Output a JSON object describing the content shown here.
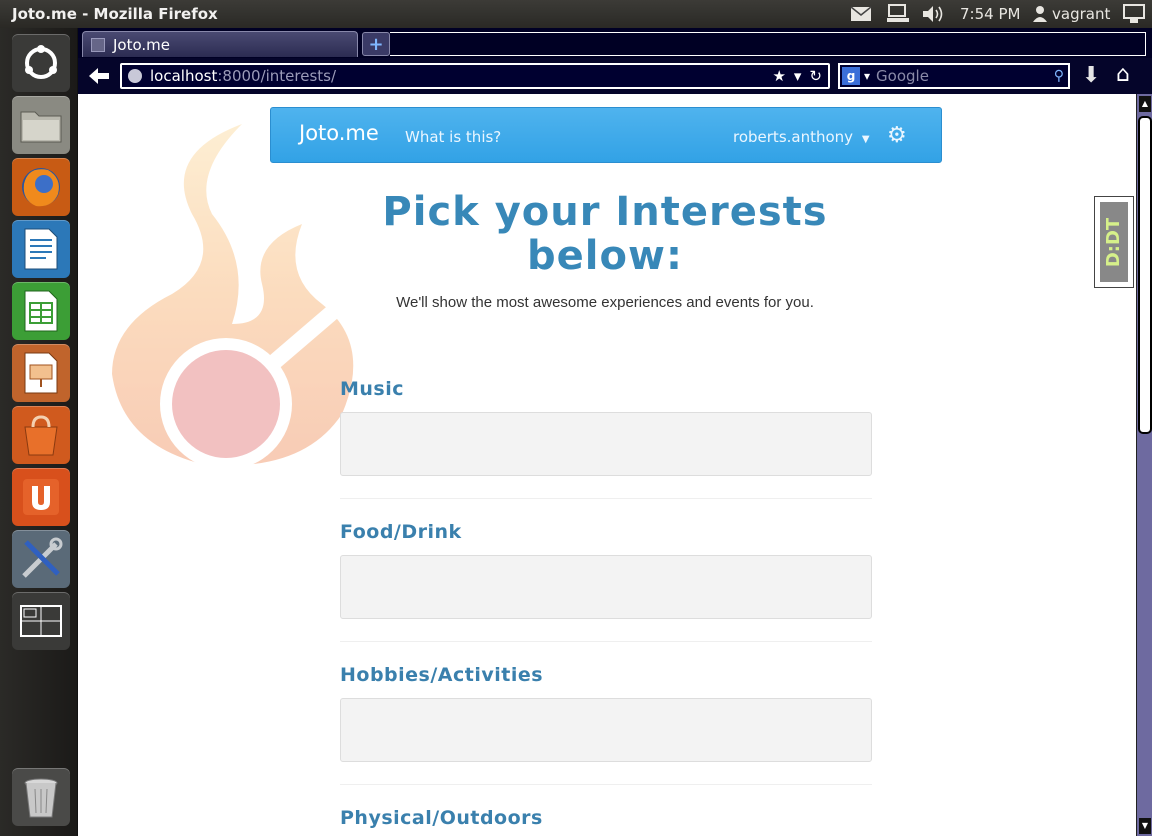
{
  "window": {
    "title": "Joto.me - Mozilla Firefox"
  },
  "panel": {
    "time": "7:54 PM",
    "user": "vagrant"
  },
  "browser": {
    "tab_title": "Joto.me",
    "new_tab_symbol": "+",
    "url_host": "localhost",
    "url_rest": ":8000/interests/",
    "search_engine_letter": "g",
    "search_placeholder": "Google"
  },
  "launcher": {
    "items": [
      "ubuntu-dash",
      "files",
      "firefox",
      "libreoffice-writer",
      "libreoffice-calc",
      "libreoffice-impress",
      "software-center",
      "ubuntu-one",
      "system-settings",
      "workspace-switcher",
      "trash"
    ]
  },
  "site": {
    "brand": "Joto.me",
    "nav_link": "What is this?",
    "user_menu": "roberts.anthony",
    "heading_line1": "Pick your Interests",
    "heading_line2": "below:",
    "subheading": "We'll show the most awesome experiences and events for you.",
    "sections": [
      "Music",
      "Food/Drink",
      "Hobbies/Activities",
      "Physical/Outdoors"
    ]
  },
  "addon": {
    "dndt_label": "D:DT"
  },
  "colors": {
    "accent": "#3888b8",
    "navbar": "#3aa6e8",
    "section_title": "#3a80ad"
  }
}
